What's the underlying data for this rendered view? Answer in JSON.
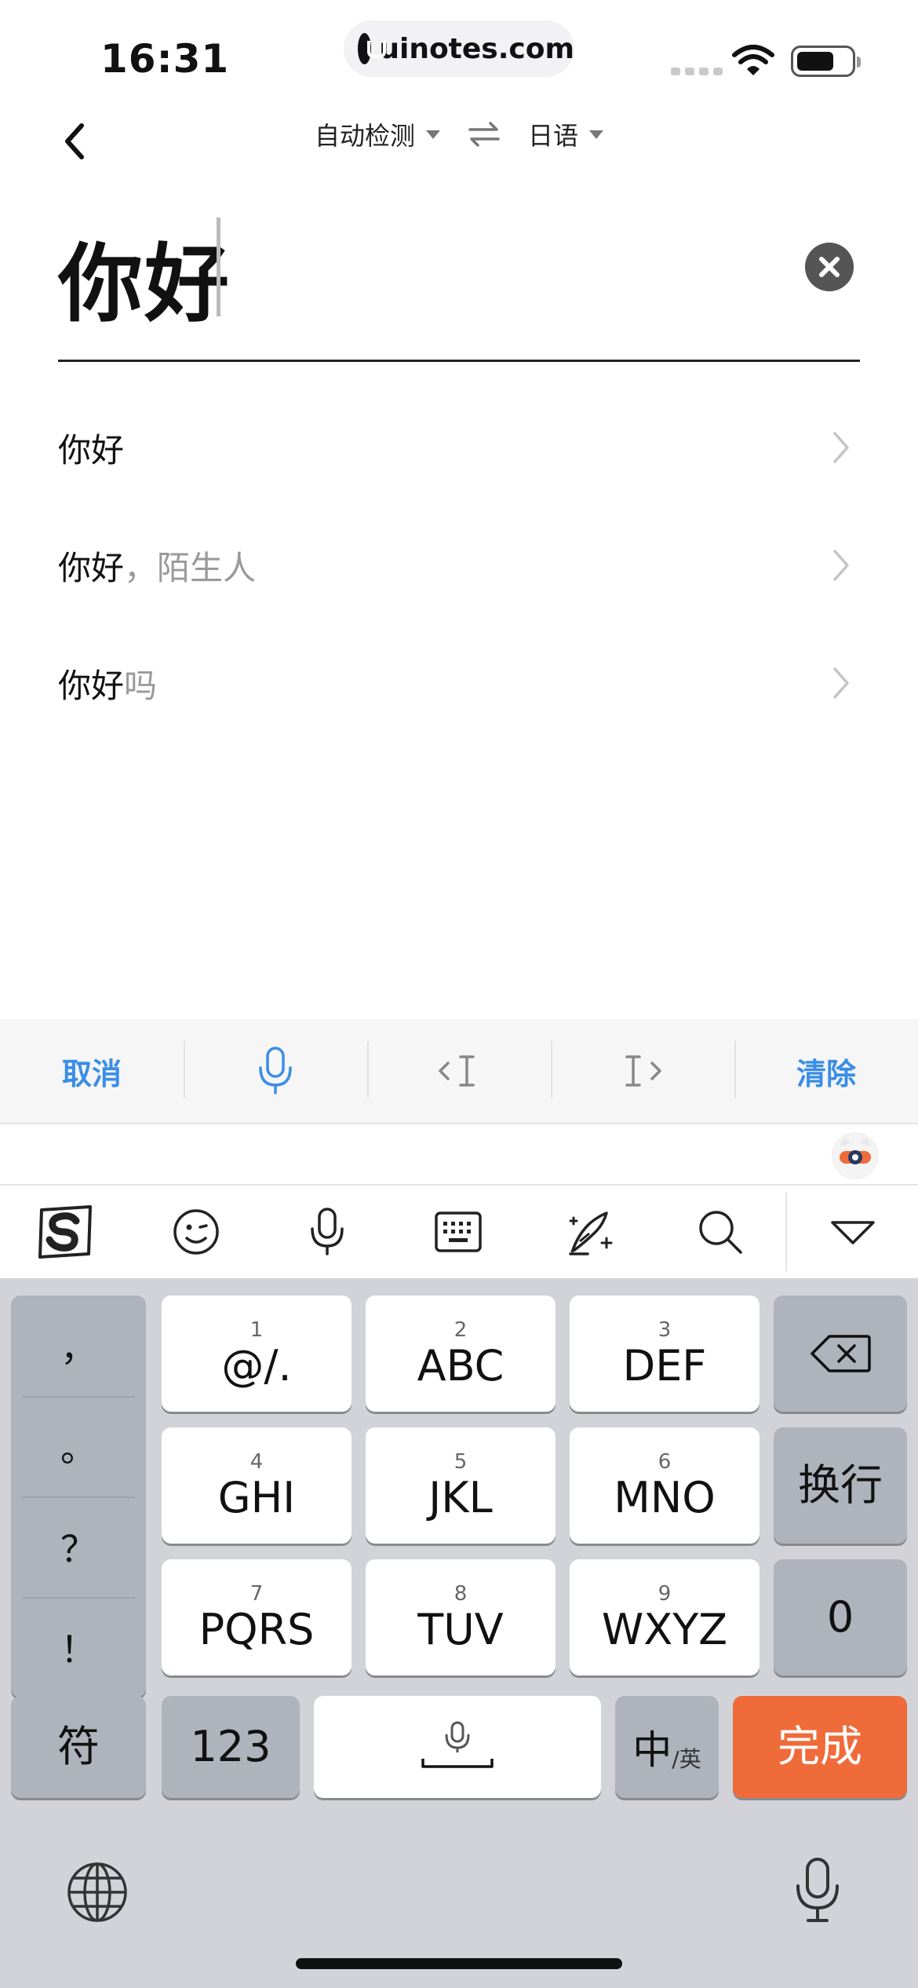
{
  "status": {
    "time": "16:31",
    "url": "uinotes.com"
  },
  "nav": {
    "source_lang": "自动检测",
    "target_lang": "日语"
  },
  "input": {
    "value": "你好"
  },
  "suggestions": [
    {
      "main": "你好",
      "extra": ""
    },
    {
      "main": "你好",
      "extra": "，陌生人"
    },
    {
      "main": "你好",
      "extra": "吗"
    }
  ],
  "toolbar": {
    "cancel": "取消",
    "clear": "清除"
  },
  "keyboard": {
    "punctuation": [
      "，",
      "。",
      "？",
      "！"
    ],
    "keys": [
      {
        "num": "1",
        "label": "@/."
      },
      {
        "num": "2",
        "label": "ABC"
      },
      {
        "num": "3",
        "label": "DEF"
      },
      {
        "num": "4",
        "label": "GHI"
      },
      {
        "num": "5",
        "label": "JKL"
      },
      {
        "num": "6",
        "label": "MNO"
      },
      {
        "num": "7",
        "label": "PQRS"
      },
      {
        "num": "8",
        "label": "TUV"
      },
      {
        "num": "9",
        "label": "WXYZ"
      }
    ],
    "newline": "换行",
    "zero": "0",
    "symbols": "符",
    "numbers": "123",
    "lang_main": "中",
    "lang_alt": "/英",
    "done": "完成"
  },
  "colors": {
    "accent": "#3a8ee6",
    "done": "#ef6b3a"
  }
}
